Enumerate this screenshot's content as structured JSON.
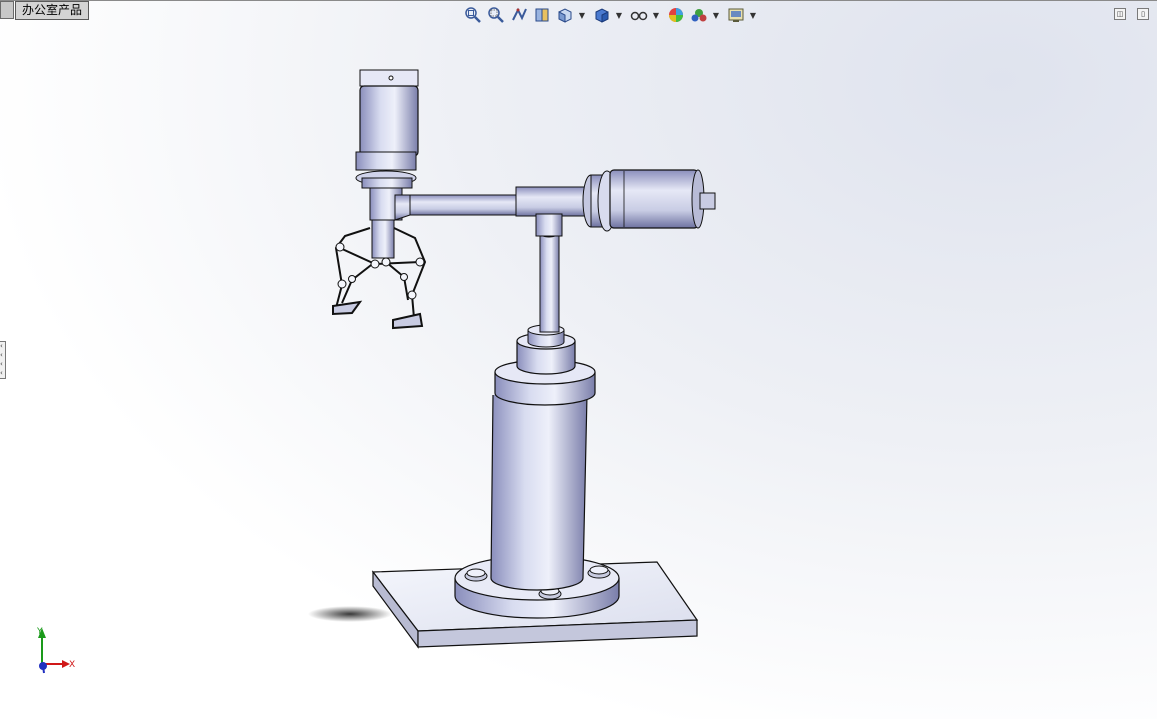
{
  "document": {
    "tab_title": "办公室产品"
  },
  "toolbar": {
    "buttons": [
      {
        "icon": "zoom-to-fit-icon"
      },
      {
        "icon": "zoom-to-area-icon"
      },
      {
        "icon": "previous-view-icon"
      },
      {
        "icon": "section-view-icon"
      },
      {
        "icon": "view-orientation-icon",
        "dropdown": true
      },
      {
        "icon": "display-style-icon",
        "dropdown": true
      },
      {
        "icon": "hide-show-items-icon",
        "dropdown": true
      },
      {
        "icon": "edit-appearance-icon"
      },
      {
        "icon": "apply-scene-icon",
        "dropdown": true
      },
      {
        "icon": "view-settings-icon",
        "dropdown": true
      }
    ]
  },
  "triad": {
    "x_label": "X",
    "y_label": "Y"
  },
  "colors": {
    "axis_x": "#d01818",
    "axis_y": "#1a9a1a",
    "axis_z": "#2030c0",
    "metal": "#b8bcd8"
  }
}
